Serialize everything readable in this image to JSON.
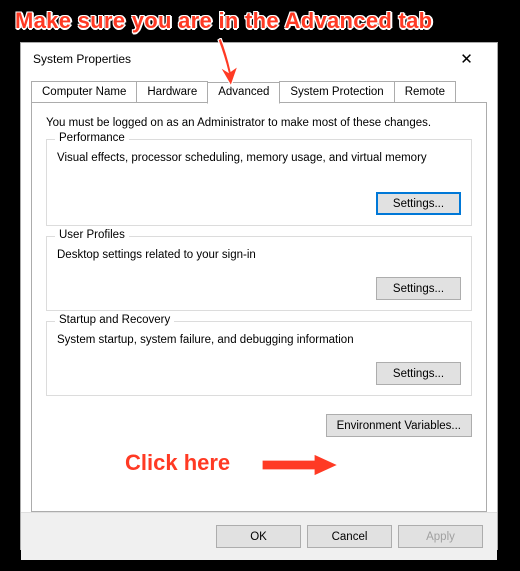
{
  "annotations": {
    "top": "Make sure you are in the Advanced tab",
    "bottom": "Click here"
  },
  "dialog": {
    "title": "System Properties"
  },
  "tabs": [
    {
      "label": "Computer Name"
    },
    {
      "label": "Hardware"
    },
    {
      "label": "Advanced"
    },
    {
      "label": "System Protection"
    },
    {
      "label": "Remote"
    }
  ],
  "activeTab": 2,
  "content": {
    "intro": "You must be logged on as an Administrator to make most of these changes.",
    "groups": {
      "performance": {
        "title": "Performance",
        "desc": "Visual effects, processor scheduling, memory usage, and virtual memory",
        "button": "Settings..."
      },
      "userProfiles": {
        "title": "User Profiles",
        "desc": "Desktop settings related to your sign-in",
        "button": "Settings..."
      },
      "startup": {
        "title": "Startup and Recovery",
        "desc": "System startup, system failure, and debugging information",
        "button": "Settings..."
      }
    },
    "envButton": "Environment Variables..."
  },
  "footer": {
    "ok": "OK",
    "cancel": "Cancel",
    "apply": "Apply"
  }
}
